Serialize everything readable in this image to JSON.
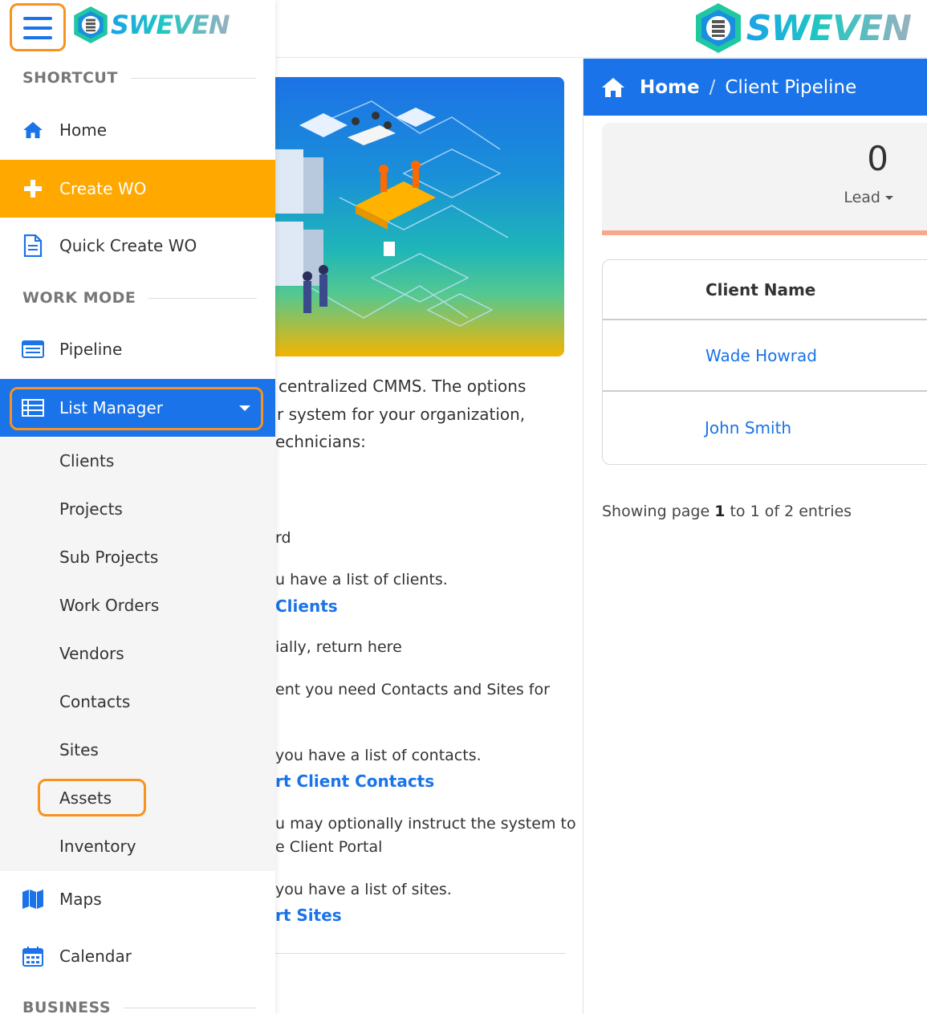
{
  "brand": {
    "logo_text": "SWEVEN"
  },
  "sidebar": {
    "sections": {
      "shortcut": "SHORTCUT",
      "work_mode": "WORK MODE",
      "business": "BUSINESS"
    },
    "items": {
      "home": "Home",
      "create_wo": "Create WO",
      "quick_create_wo": "Quick Create WO",
      "pipeline": "Pipeline",
      "list_manager": "List Manager",
      "maps": "Maps",
      "calendar": "Calendar"
    },
    "submenu": [
      "Clients",
      "Projects",
      "Sub Projects",
      "Work Orders",
      "Vendors",
      "Contacts",
      "Sites",
      "Assets",
      "Inventory"
    ]
  },
  "main": {
    "paragraph": [
      "centralized CMMS. The options",
      "r system for your organization,",
      "echnicians:"
    ],
    "lines": {
      "l1": "rd",
      "l2": "u have a list of clients.",
      "link_clients": "Clients",
      "l3": "ially, return here",
      "l4": "ent you need Contacts and Sites for",
      "l5": "you have a list of contacts.",
      "link_contacts": "rt Client Contacts",
      "l6": "u may optionally instruct the system to",
      "l7": "e Client Portal",
      "l8": "you have a list of sites.",
      "link_sites": "rt Sites"
    }
  },
  "breadcrumb": {
    "home": "Home",
    "separator": "/",
    "current": "Client Pipeline"
  },
  "stat": {
    "value": "0",
    "label": "Lead"
  },
  "table": {
    "header": "Client Name",
    "rows": [
      "Wade Howrad",
      "John Smith"
    ]
  },
  "pagination": {
    "prefix": "Showing page",
    "page": "1",
    "suffix": "to 1 of 2 entries"
  },
  "colors": {
    "primary": "#1a73e8",
    "accent": "#ffa800",
    "highlight": "#f7931e",
    "stat_bar": "#f8a78a"
  }
}
